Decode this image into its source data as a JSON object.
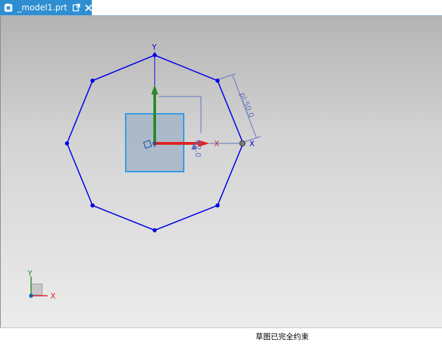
{
  "tab": {
    "title": "_model1.prt",
    "icon": "part-file-icon"
  },
  "sketch": {
    "dimension_d": "pl:50.0",
    "dimension_r": "R2.0",
    "axis_x": "X",
    "axis_y": "Y",
    "line_color": "#0000e6",
    "x_axis_color": "#e02020",
    "y_axis_color": "#2a8a2a",
    "dimension_color": "#5b6fc0"
  },
  "triad": {
    "x_label": "X",
    "y_label": "Y"
  },
  "status": {
    "message": "草图已完全约束"
  }
}
